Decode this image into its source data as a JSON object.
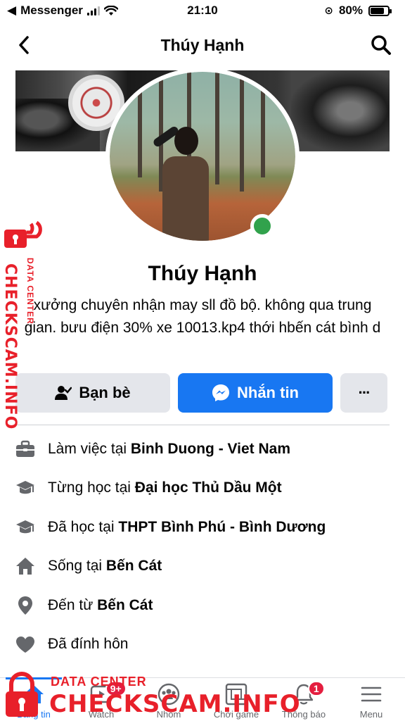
{
  "status_bar": {
    "app": "Messenger",
    "time": "21:10",
    "battery": "80%",
    "battery_level": 0.8
  },
  "header": {
    "title": "Thúy Hạnh"
  },
  "profile": {
    "name": "Thúy Hạnh",
    "bio": "xưởng chuyên nhận may sll đồ bộ. không qua trung gian. bưu điện 30% xe 10013.kp4 thới hbến cát bình d",
    "online": true
  },
  "actions": {
    "friends_label": "Bạn bè",
    "message_label": "Nhắn tin",
    "more_label": "···"
  },
  "details": [
    {
      "icon": "briefcase-icon",
      "prefix": "Làm việc tại ",
      "value": "Binh Duong - Viet Nam"
    },
    {
      "icon": "graduation-cap-icon",
      "prefix": "Từng học tại ",
      "value": "Đại học Thủ Dầu Một"
    },
    {
      "icon": "graduation-cap-icon",
      "prefix": "Đã học tại ",
      "value": "THPT Bình Phú - Bình Dương"
    },
    {
      "icon": "home-icon",
      "prefix": "Sống tại ",
      "value": "Bến Cát"
    },
    {
      "icon": "location-pin-icon",
      "prefix": "Đến từ ",
      "value": "Bến Cát"
    },
    {
      "icon": "heart-icon",
      "prefix": "Đã đính hôn",
      "value": ""
    }
  ],
  "tab_bar": {
    "tabs": [
      {
        "label": "Bảng tin",
        "icon": "home-feed-icon",
        "active": true
      },
      {
        "label": "Watch",
        "icon": "watch-icon",
        "badge": "9+"
      },
      {
        "label": "Nhóm",
        "icon": "groups-icon"
      },
      {
        "label": "Chơi game",
        "icon": "gaming-icon"
      },
      {
        "label": "Thông báo",
        "icon": "bell-icon",
        "badge": "1"
      },
      {
        "label": "Menu",
        "icon": "menu-icon"
      }
    ]
  },
  "watermark": {
    "side_main": "CHECKSCAM.INFO",
    "side_sub": "DATA CENTER",
    "bottom_sub": "DATA CENTER",
    "bottom_main": "CHECKSCAM.INFO",
    "color": "#e8202a"
  },
  "colors": {
    "accent": "#1877f2",
    "online": "#31a24c",
    "badge": "#e41e3f"
  }
}
